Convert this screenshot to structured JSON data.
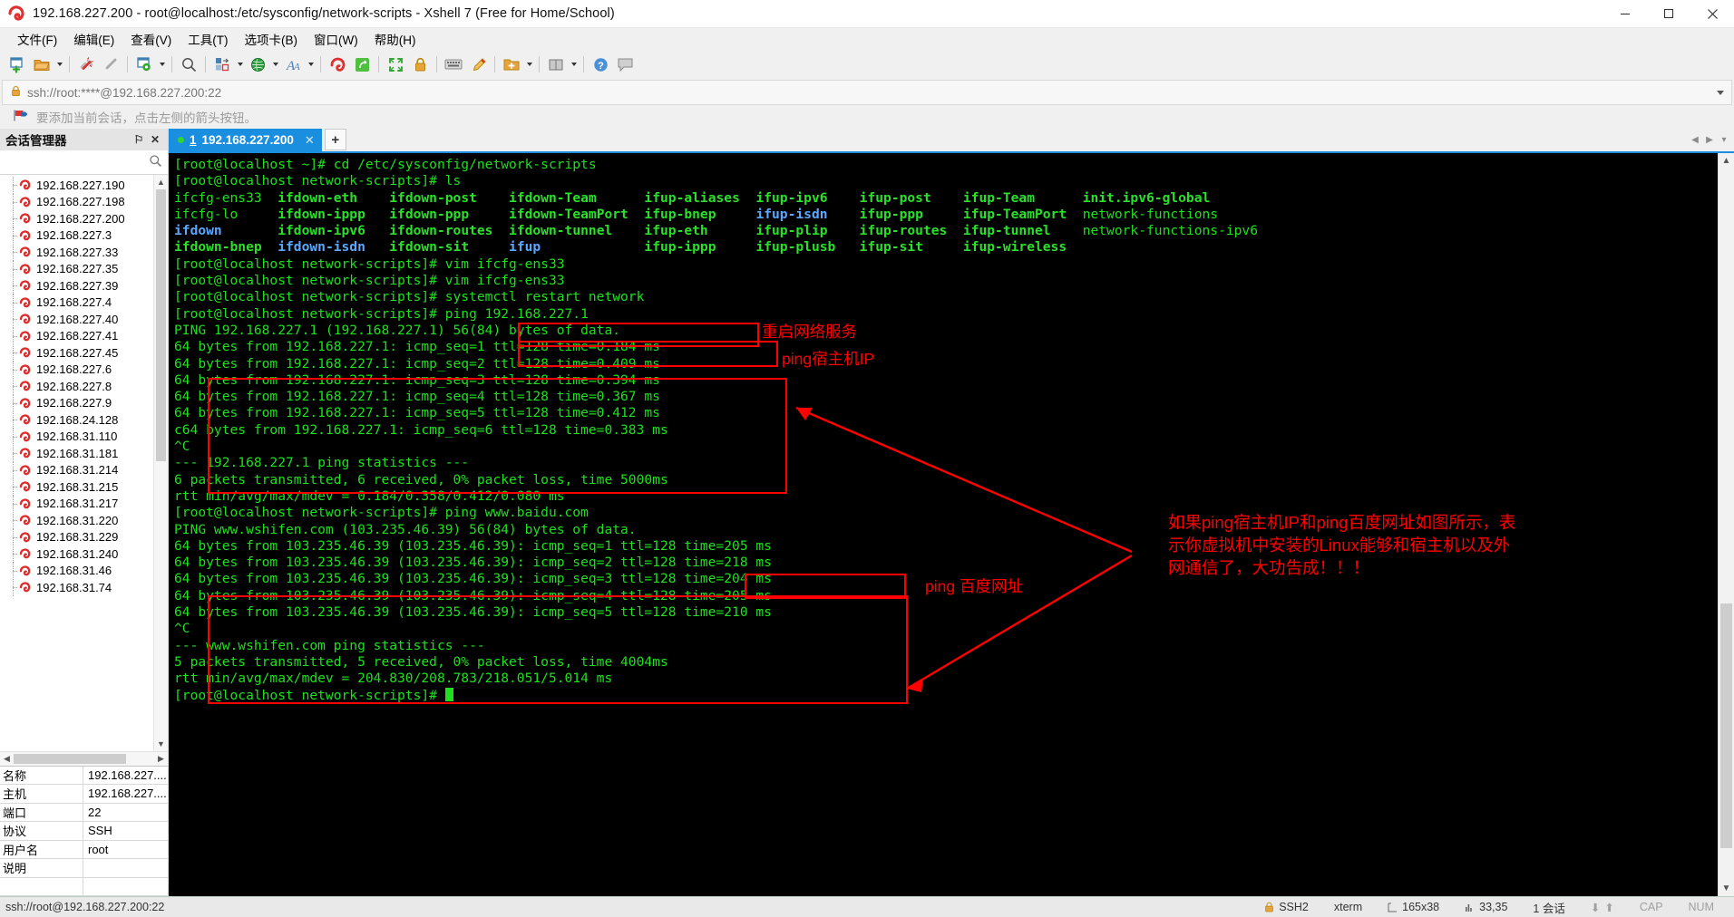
{
  "window": {
    "title": "192.168.227.200 - root@localhost:/etc/sysconfig/network-scripts - Xshell 7 (Free for Home/School)",
    "minimize_label": "─",
    "maximize_label": "❐",
    "close_label": "✕"
  },
  "menu": {
    "items": [
      {
        "label": "文件(F)"
      },
      {
        "label": "编辑(E)"
      },
      {
        "label": "查看(V)"
      },
      {
        "label": "工具(T)"
      },
      {
        "label": "选项卡(B)"
      },
      {
        "label": "窗口(W)"
      },
      {
        "label": "帮助(H)"
      }
    ]
  },
  "toolbar": {
    "buttons": [
      {
        "name": "new-session-icon",
        "caret": false
      },
      {
        "name": "open-folder-icon",
        "caret": true
      },
      {
        "name": "sep1",
        "caret": false
      },
      {
        "name": "disconnect-icon",
        "caret": false
      },
      {
        "name": "reconnect-icon",
        "caret": false
      },
      {
        "name": "sep2",
        "caret": false
      },
      {
        "name": "session-properties-icon",
        "caret": true
      },
      {
        "name": "sep3",
        "caret": false
      },
      {
        "name": "find-icon",
        "caret": false
      },
      {
        "name": "layout-icon",
        "caret": true
      },
      {
        "name": "globe-icon",
        "caret": true
      },
      {
        "name": "font-icon",
        "caret": true
      },
      {
        "name": "sep4",
        "caret": false
      },
      {
        "name": "xshell-icon",
        "caret": false
      },
      {
        "name": "xftp-icon",
        "caret": false
      },
      {
        "name": "sep5",
        "caret": false
      },
      {
        "name": "fullscreen-icon",
        "caret": false
      },
      {
        "name": "lock-icon",
        "caret": false
      },
      {
        "name": "sep6",
        "caret": false
      },
      {
        "name": "keyboard-icon",
        "caret": false
      },
      {
        "name": "highlight-icon",
        "caret": false
      },
      {
        "name": "sep7",
        "caret": false
      },
      {
        "name": "add-folder-icon",
        "caret": true
      },
      {
        "name": "sep8",
        "caret": false
      },
      {
        "name": "layout2-icon",
        "caret": true
      },
      {
        "name": "sep9",
        "caret": false
      },
      {
        "name": "help-icon",
        "caret": false
      },
      {
        "name": "comment-icon",
        "caret": false
      }
    ]
  },
  "address_bar": {
    "value": "ssh://root:****@192.168.227.200:22",
    "lock_icon": "lock-icon"
  },
  "hint_bar": {
    "text": "要添加当前会话，点击左侧的箭头按钮。"
  },
  "sidebar": {
    "title": "会话管理器",
    "pin_label": "⚐",
    "close_label": "✕",
    "search_icon": "search-icon",
    "sessions": [
      "192.168.227.190",
      "192.168.227.198",
      "192.168.227.200",
      "192.168.227.3",
      "192.168.227.33",
      "192.168.227.35",
      "192.168.227.39",
      "192.168.227.4",
      "192.168.227.40",
      "192.168.227.41",
      "192.168.227.45",
      "192.168.227.6",
      "192.168.227.8",
      "192.168.227.9",
      "192.168.24.128",
      "192.168.31.110",
      "192.168.31.181",
      "192.168.31.214",
      "192.168.31.215",
      "192.168.31.217",
      "192.168.31.220",
      "192.168.31.229",
      "192.168.31.240",
      "192.168.31.46",
      "192.168.31.74"
    ],
    "properties": [
      {
        "key": "名称",
        "value": "192.168.227...."
      },
      {
        "key": "主机",
        "value": "192.168.227...."
      },
      {
        "key": "端口",
        "value": "22"
      },
      {
        "key": "协议",
        "value": "SSH"
      },
      {
        "key": "用户名",
        "value": "root"
      },
      {
        "key": "说明",
        "value": ""
      },
      {
        "key": "",
        "value": ""
      }
    ]
  },
  "tabs": {
    "items": [
      {
        "number": "1",
        "label": "192.168.227.200",
        "close_label": "✕",
        "active": true
      }
    ],
    "add_label": "+",
    "nav_left": "◀",
    "nav_right": "▶",
    "nav_menu": "▾"
  },
  "terminal": {
    "lines": [
      [
        {
          "t": "[root@localhost ~]# cd /etc/sysconfig/network-scripts",
          "c": "t-green"
        }
      ],
      [
        {
          "t": "[root@localhost network-scripts]# ls",
          "c": "t-green"
        }
      ],
      [
        {
          "t": "ifcfg-ens33  ",
          "c": "t-green"
        },
        {
          "t": "ifdown-eth    ",
          "c": "t-bgreen"
        },
        {
          "t": "ifdown-post    ",
          "c": "t-bgreen"
        },
        {
          "t": "ifdown-Team      ",
          "c": "t-bgreen"
        },
        {
          "t": "ifup-aliases  ",
          "c": "t-bgreen"
        },
        {
          "t": "ifup-ipv6    ",
          "c": "t-bgreen"
        },
        {
          "t": "ifup-post    ",
          "c": "t-bgreen"
        },
        {
          "t": "ifup-Team      ",
          "c": "t-bgreen"
        },
        {
          "t": "init.ipv6-global",
          "c": "t-bgreen"
        }
      ],
      [
        {
          "t": "ifcfg-lo     ",
          "c": "t-green"
        },
        {
          "t": "ifdown-ippp   ",
          "c": "t-bgreen"
        },
        {
          "t": "ifdown-ppp     ",
          "c": "t-bgreen"
        },
        {
          "t": "ifdown-TeamPort  ",
          "c": "t-bgreen"
        },
        {
          "t": "ifup-bnep     ",
          "c": "t-bgreen"
        },
        {
          "t": "ifup-isdn    ",
          "c": "t-bblue"
        },
        {
          "t": "ifup-ppp     ",
          "c": "t-bgreen"
        },
        {
          "t": "ifup-TeamPort  ",
          "c": "t-bgreen"
        },
        {
          "t": "network-functions",
          "c": "t-green"
        }
      ],
      [
        {
          "t": "ifdown       ",
          "c": "t-bblue"
        },
        {
          "t": "ifdown-ipv6   ",
          "c": "t-bgreen"
        },
        {
          "t": "ifdown-routes  ",
          "c": "t-bgreen"
        },
        {
          "t": "ifdown-tunnel    ",
          "c": "t-bgreen"
        },
        {
          "t": "ifup-eth      ",
          "c": "t-bgreen"
        },
        {
          "t": "ifup-plip    ",
          "c": "t-bgreen"
        },
        {
          "t": "ifup-routes  ",
          "c": "t-bgreen"
        },
        {
          "t": "ifup-tunnel    ",
          "c": "t-bgreen"
        },
        {
          "t": "network-functions-ipv6",
          "c": "t-green"
        }
      ],
      [
        {
          "t": "ifdown-bnep  ",
          "c": "t-bgreen"
        },
        {
          "t": "ifdown-isdn   ",
          "c": "t-bblue"
        },
        {
          "t": "ifdown-sit     ",
          "c": "t-bgreen"
        },
        {
          "t": "ifup             ",
          "c": "t-bblue"
        },
        {
          "t": "ifup-ippp     ",
          "c": "t-bgreen"
        },
        {
          "t": "ifup-plusb   ",
          "c": "t-bgreen"
        },
        {
          "t": "ifup-sit     ",
          "c": "t-bgreen"
        },
        {
          "t": "ifup-wireless",
          "c": "t-bgreen"
        }
      ],
      [
        {
          "t": "[root@localhost network-scripts]# vim ifcfg-ens33",
          "c": "t-green"
        }
      ],
      [
        {
          "t": "[root@localhost network-scripts]# vim ifcfg-ens33",
          "c": "t-green"
        }
      ],
      [
        {
          "t": "[root@localhost network-scripts]# systemctl restart network",
          "c": "t-green"
        }
      ],
      [
        {
          "t": "[root@localhost network-scripts]# ping 192.168.227.1",
          "c": "t-green"
        }
      ],
      [
        {
          "t": "PING 192.168.227.1 (192.168.227.1) 56(84) bytes of data.",
          "c": "t-green"
        }
      ],
      [
        {
          "t": "64 bytes from 192.168.227.1: icmp_seq=1 ttl=128 time=0.184 ms",
          "c": "t-green"
        }
      ],
      [
        {
          "t": "64 bytes from 192.168.227.1: icmp_seq=2 ttl=128 time=0.409 ms",
          "c": "t-green"
        }
      ],
      [
        {
          "t": "64 bytes from 192.168.227.1: icmp_seq=3 ttl=128 time=0.394 ms",
          "c": "t-green"
        }
      ],
      [
        {
          "t": "64 bytes from 192.168.227.1: icmp_seq=4 ttl=128 time=0.367 ms",
          "c": "t-green"
        }
      ],
      [
        {
          "t": "64 bytes from 192.168.227.1: icmp_seq=5 ttl=128 time=0.412 ms",
          "c": "t-green"
        }
      ],
      [
        {
          "t": "c64 bytes from 192.168.227.1: icmp_seq=6 ttl=128 time=0.383 ms",
          "c": "t-green"
        }
      ],
      [
        {
          "t": "^C",
          "c": "t-green"
        }
      ],
      [
        {
          "t": "--- 192.168.227.1 ping statistics ---",
          "c": "t-green"
        }
      ],
      [
        {
          "t": "6 packets transmitted, 6 received, 0% packet loss, time 5000ms",
          "c": "t-green"
        }
      ],
      [
        {
          "t": "rtt min/avg/max/mdev = 0.184/0.358/0.412/0.080 ms",
          "c": "t-green"
        }
      ],
      [
        {
          "t": "[root@localhost network-scripts]# ping www.baidu.com",
          "c": "t-green"
        }
      ],
      [
        {
          "t": "PING www.wshifen.com (103.235.46.39) 56(84) bytes of data.",
          "c": "t-green"
        }
      ],
      [
        {
          "t": "64 bytes from 103.235.46.39 (103.235.46.39): icmp_seq=1 ttl=128 time=205 ms",
          "c": "t-green"
        }
      ],
      [
        {
          "t": "64 bytes from 103.235.46.39 (103.235.46.39): icmp_seq=2 ttl=128 time=218 ms",
          "c": "t-green"
        }
      ],
      [
        {
          "t": "64 bytes from 103.235.46.39 (103.235.46.39): icmp_seq=3 ttl=128 time=204 ms",
          "c": "t-green"
        }
      ],
      [
        {
          "t": "64 bytes from 103.235.46.39 (103.235.46.39): icmp_seq=4 ttl=128 time=205 ms",
          "c": "t-green"
        }
      ],
      [
        {
          "t": "64 bytes from 103.235.46.39 (103.235.46.39): icmp_seq=5 ttl=128 time=210 ms",
          "c": "t-green"
        }
      ],
      [
        {
          "t": "^C",
          "c": "t-green"
        }
      ],
      [
        {
          "t": "--- www.wshifen.com ping statistics ---",
          "c": "t-green"
        }
      ],
      [
        {
          "t": "5 packets transmitted, 5 received, 0% packet loss, time 4004ms",
          "c": "t-green"
        }
      ],
      [
        {
          "t": "rtt min/avg/max/mdev = 204.830/208.783/218.051/5.014 ms",
          "c": "t-green"
        }
      ],
      [
        {
          "t": "[root@localhost network-scripts]# ",
          "c": "t-green"
        }
      ]
    ]
  },
  "annotations": {
    "color": "#ff0000",
    "label_restart": "重启网络服务",
    "label_ping_host": "ping宿主机IP",
    "label_ping_baidu": "ping 百度网址",
    "note_line1": "如果ping宿主机IP和ping百度网址如图所示，表",
    "note_line2": "示你虚拟机中安装的Linux能够和宿主机以及外",
    "note_line3": "网通信了，大功告成！！！"
  },
  "statusbar": {
    "left": "ssh://root@192.168.227.200:22",
    "protocol": "SSH2",
    "term_type": "xterm",
    "size": "165x38",
    "cursor": "33,35",
    "sessions": "1 会话",
    "cap": "CAP",
    "num": "NUM"
  }
}
